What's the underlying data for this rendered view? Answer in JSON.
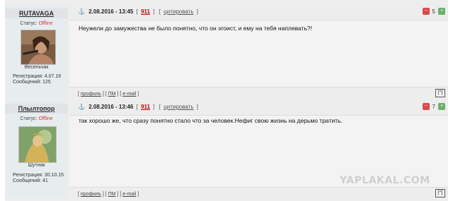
{
  "posts": [
    {
      "username": "RUTAVAGA",
      "status_label": "Статус:",
      "status_value": "Offline",
      "rank": "Весельчак",
      "reg": "Регистрация: 4.07.16",
      "msgs": "Сообщений: 125",
      "date": "2.08.2016 - 13:45",
      "bracket_open": "[",
      "bracket_close": "]",
      "post_num": "911",
      "cite": "цитировать",
      "karma": "5",
      "text": "Неужели до замужества не было понятно, что он эгоист, и ему на тебя наплевать?!",
      "links": {
        "profile": "профиль",
        "pm": "ПМ",
        "email": "e-mail"
      },
      "top": "[^]"
    },
    {
      "username": "Плылтопор",
      "status_label": "Статус:",
      "status_value": "Offline",
      "rank": "Шутник",
      "reg": "Регистрация: 30.10.15",
      "msgs": "Сообщений: 41",
      "date": "2.08.2016 - 13:46",
      "bracket_open": "[",
      "bracket_close": "]",
      "post_num": "911",
      "cite": "цитировать",
      "karma": "7",
      "text": "так хорошо же, что сразу понятно стало что за человек.Нефиг свою жизнь на дерьмо тратить.",
      "links": {
        "profile": "профиль",
        "pm": "ПМ",
        "email": "e-mail"
      },
      "top": "[^]"
    }
  ],
  "watermark": "YAPLAKAL.COM"
}
